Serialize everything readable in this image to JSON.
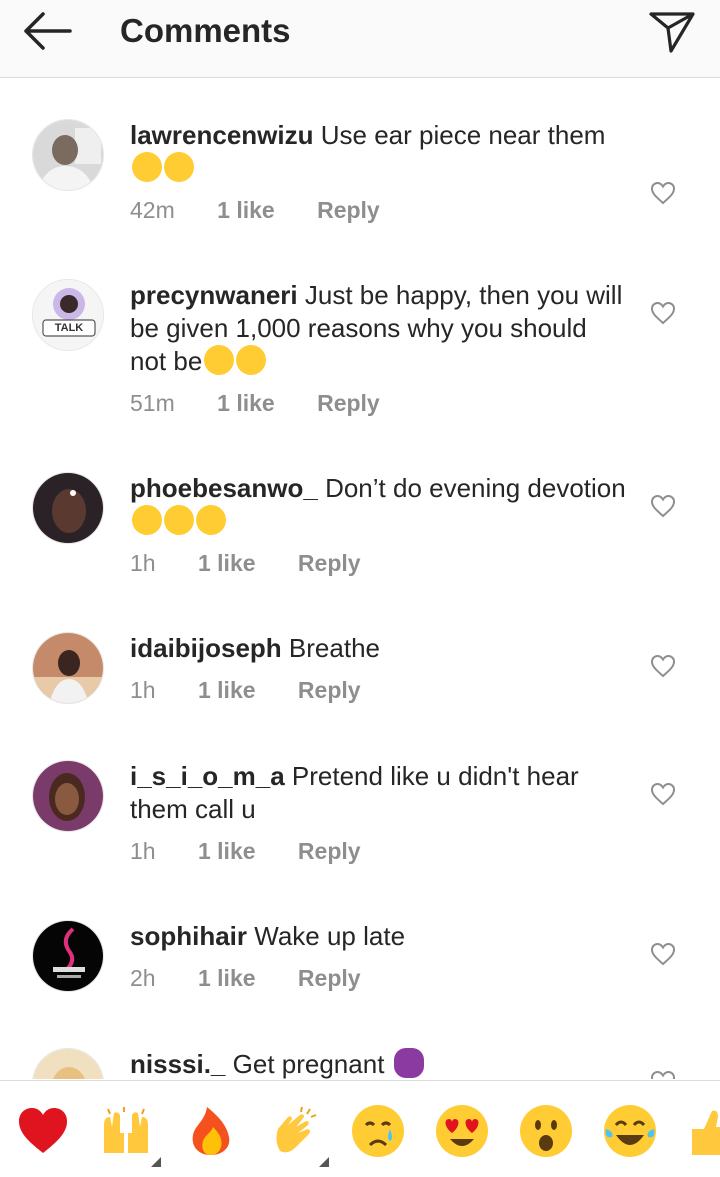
{
  "header": {
    "title": "Comments"
  },
  "comments": [
    {
      "username": "lawrencenwizu",
      "text": "Use ear piece near them",
      "time": "42m",
      "likes": "1 like",
      "reply": "Reply"
    },
    {
      "username": "precynwaneri",
      "text": "Just be happy, then you will be given 1,000 reasons why you should not be",
      "time": "51m",
      "likes": "1 like",
      "reply": "Reply",
      "avatar_text": "TALK"
    },
    {
      "username": "phoebesanwo_",
      "text": "Don’t do evening devotion",
      "time": "1h",
      "likes": "1 like",
      "reply": "Reply"
    },
    {
      "username": "idaibijoseph",
      "text": "Breathe",
      "time": "1h",
      "likes": "1 like",
      "reply": "Reply"
    },
    {
      "username": "i_s_i_o_m_a",
      "text": "Pretend like u didn't hear them call u",
      "time": "1h",
      "likes": "1 like",
      "reply": "Reply"
    },
    {
      "username": "sophihair",
      "text": "Wake up late",
      "time": "2h",
      "likes": "1 like",
      "reply": "Reply"
    },
    {
      "username": "nisssi._",
      "text": "Get pregnant"
    }
  ],
  "emoji_bar": [
    "red-heart",
    "raising-hands",
    "fire",
    "clapping-hands",
    "crying-face",
    "heart-eyes-face",
    "surprised-face",
    "tears-of-joy-face",
    "thumbs-up"
  ],
  "colors": {
    "text": "#262626",
    "meta": "#8e8e8e",
    "divider": "#dbdbdb",
    "header_bg": "#fafafa"
  }
}
